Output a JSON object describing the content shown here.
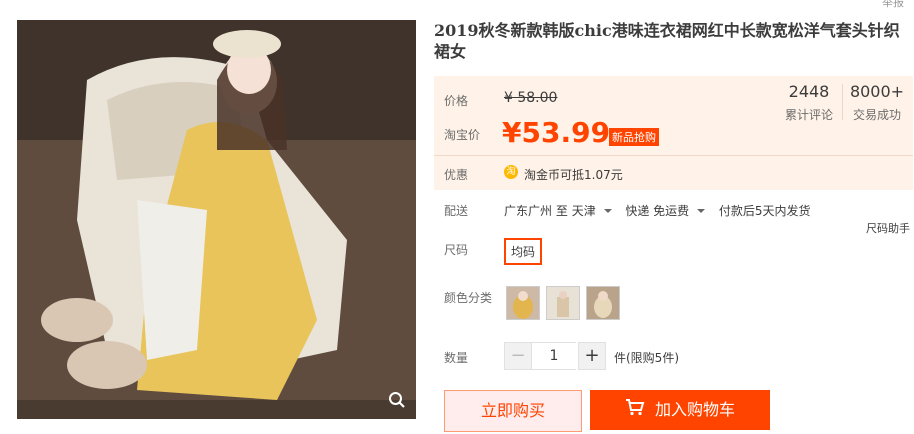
{
  "header": {
    "report_label": "举报"
  },
  "product": {
    "title": "2019秋冬新款韩版chic港味连衣裙网红中长款宽松洋气套头针织裙女"
  },
  "price": {
    "label": "价格",
    "original": "¥ 58.00",
    "taobao_label": "淘宝价",
    "current": "¥53.99",
    "badge": "新品抢购"
  },
  "stats": {
    "reviews_count": "2448",
    "reviews_label": "累计评论",
    "sales_count": "8000+",
    "sales_label": "交易成功"
  },
  "promo": {
    "label": "优惠",
    "coin_icon_text": "淘",
    "text": "淘金币可抵",
    "amount": "1.07元"
  },
  "shipping": {
    "label": "配送",
    "from": "广东广州",
    "to_word": "至",
    "dest": "天津",
    "method": "快递 免运费",
    "time": "付款后5天内发货"
  },
  "size_helper": "尺码助手",
  "size": {
    "label": "尺码",
    "option": "均码"
  },
  "color": {
    "label": "颜色分类"
  },
  "quantity": {
    "label": "数量",
    "minus": "−",
    "value": "1",
    "plus": "+",
    "unit": "件(限购5件)"
  },
  "actions": {
    "buy_now": "立即购买",
    "add_cart": "加入购物车",
    "cart_icon": "cart-icon"
  },
  "colors": {
    "accent": "#ff4400",
    "price_bg": "#fff2e8"
  }
}
